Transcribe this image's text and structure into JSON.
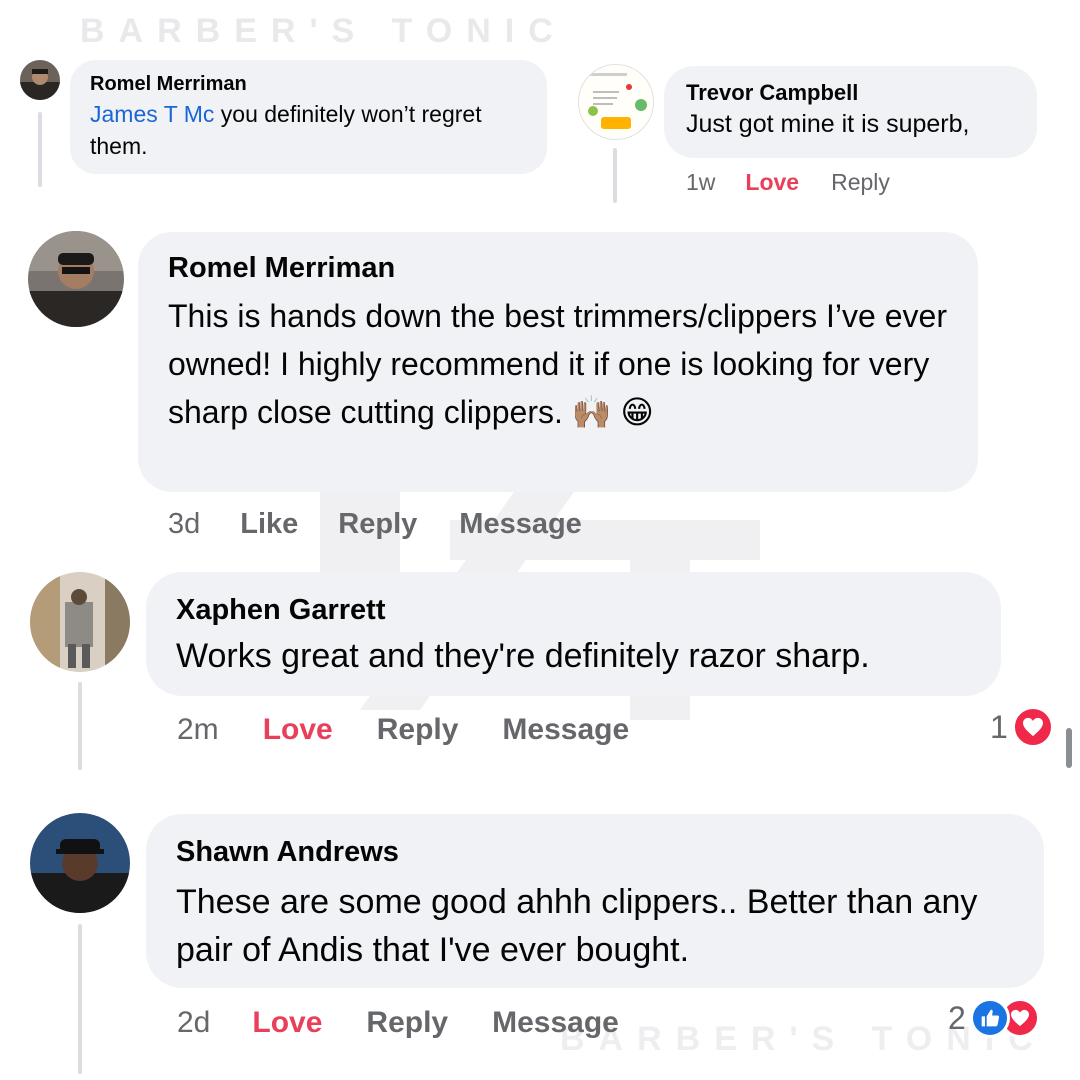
{
  "watermark": {
    "text": "BARBER'S TONIC"
  },
  "colors": {
    "love": "#e8405a",
    "meta": "#65676b",
    "bubble": "#f0f2f5",
    "link": "#1b66d6",
    "like_blue": "#1b74e4"
  },
  "comments": [
    {
      "author": "Romel Merriman",
      "mention": "James T Mc",
      "text": " you definitely won’t regret them."
    },
    {
      "author": "Trevor Campbell",
      "text": "Just got mine it is superb,",
      "time": "1w",
      "reaction_label": "Love",
      "reply_label": "Reply"
    },
    {
      "author": "Romel Merriman",
      "text": "This is hands down the best trimmers/clippers I’ve ever owned! I highly recommend it if one is looking for very sharp close cutting clippers. 🙌🏽 😁",
      "time": "3d",
      "reaction_label": "Like",
      "reply_label": "Reply",
      "message_label": "Message"
    },
    {
      "author": "Xaphen Garrett",
      "text": "Works great and they're definitely razor sharp.",
      "time": "2m",
      "reaction_label": "Love",
      "reply_label": "Reply",
      "message_label": "Message",
      "reaction_count": "1",
      "reaction_icons": [
        "heart-icon"
      ]
    },
    {
      "author": "Shawn Andrews",
      "text": "These are some good ahhh clippers.. Better than any pair of Andis that I've ever bought.",
      "time": "2d",
      "reaction_label": "Love",
      "reply_label": "Reply",
      "message_label": "Message",
      "reaction_count": "2",
      "reaction_icons": [
        "thumbs-up-icon",
        "heart-icon"
      ]
    }
  ]
}
